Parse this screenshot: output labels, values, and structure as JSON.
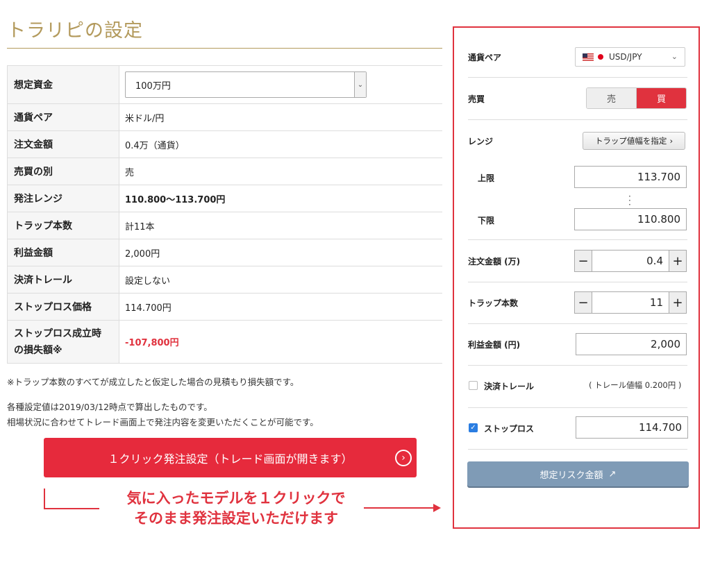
{
  "page": {
    "title": "トラリピの設定"
  },
  "summary": {
    "rows": [
      {
        "label": "想定資金",
        "value": "100万円"
      },
      {
        "label": "通貨ペア",
        "value": "米ドル/円"
      },
      {
        "label": "注文金額",
        "value": "0.4万（通貨）"
      },
      {
        "label": "売買の別",
        "value": "売"
      },
      {
        "label": "発注レンジ",
        "value": "110.800〜113.700円"
      },
      {
        "label": "トラップ本数",
        "value": "計11本"
      },
      {
        "label": "利益金額",
        "value": "2,000円"
      },
      {
        "label": "決済トレール",
        "value": "設定しない"
      },
      {
        "label": "ストップロス価格",
        "value": "114.700円"
      },
      {
        "label_line1": "ストップロス成立時",
        "label_line2": "の損失額※",
        "value": "-107,800円"
      }
    ]
  },
  "notes": {
    "footnote": "※トラップ本数のすべてが成立したと仮定した場合の見積もり損失額です。",
    "calc_time": "各種設定値は2019/03/12時点で算出したものです。",
    "change_info": "相場状況に合わせてトレード画面上で発注内容を変更いただくことが可能です。"
  },
  "cta": {
    "label": "１クリック発注設定（トレード画面が開きます）"
  },
  "callout": {
    "line1": "気に入ったモデルを１クリックで",
    "line2": "そのまま発注設定いただけます"
  },
  "panel": {
    "pair_label": "通貨ペア",
    "pair_value": "USD/JPY",
    "side_label": "売買",
    "sell_label": "売",
    "buy_label": "買",
    "range_label": "レンジ",
    "trap_width_button": "トラップ値幅を指定",
    "upper_label": "上限",
    "upper_value": "113.700",
    "lower_label": "下限",
    "lower_value": "110.800",
    "amount_label": "注文金額 (万)",
    "amount_value": "0.4",
    "traps_label": "トラップ本数",
    "traps_value": "11",
    "profit_label": "利益金額 (円)",
    "profit_value": "2,000",
    "trail_label": "決済トレール",
    "trail_note": "( トレール値幅 0.200円 )",
    "stoploss_label": "ストップロス",
    "stoploss_value": "114.700",
    "risk_button": "想定リスク金額"
  },
  "colors": {
    "accent_red": "#e62a3c",
    "gold": "#b39a5c",
    "risk_button": "#7f9bb6",
    "checkbox_blue": "#2a7de1"
  }
}
